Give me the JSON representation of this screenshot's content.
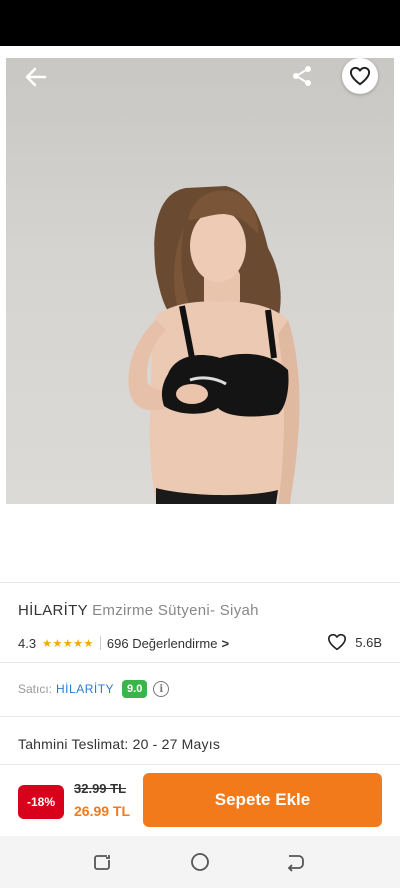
{
  "product": {
    "brand": "HİLARİTY",
    "name": "Emzirme Sütyeni- Siyah",
    "rating": "4.3",
    "stars_icon": "★★★★★",
    "review_count": "696 Değerlendirme",
    "review_chevron": ">",
    "favorite_count": "5.6B"
  },
  "seller": {
    "label": "Satıcı:",
    "name": "HİLARİTY",
    "score": "9.0",
    "info_glyph": "i"
  },
  "delivery": {
    "text": "Tahmini Teslimat: 20 - 27 Mayıs"
  },
  "pricing": {
    "discount": "-18%",
    "old_price": "32.99 TL",
    "new_price": "26.99 TL",
    "add_to_cart_label": "Sepete Ekle"
  },
  "colors": {
    "accent": "#f27a1a",
    "discount_red": "#d9001b",
    "seller_blue": "#2c7bd1",
    "score_green": "#3bb54a",
    "star_gold": "#f2a900"
  },
  "icons": {
    "back": "arrow-left-icon",
    "share": "share-icon",
    "favorite": "heart-outline-icon",
    "info": "info-icon",
    "nav_recents": "recents-icon",
    "nav_home": "home-circle-icon",
    "nav_back": "nav-back-icon"
  }
}
